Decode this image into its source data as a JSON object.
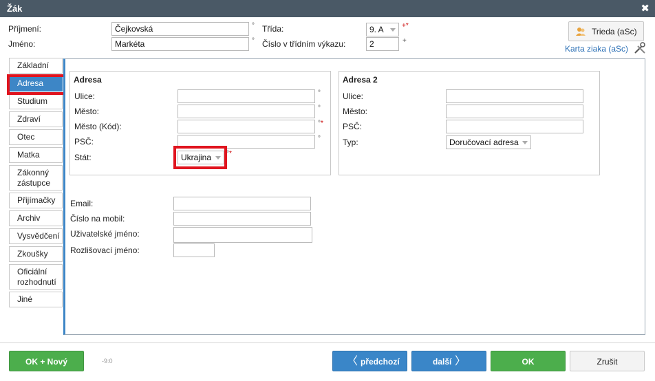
{
  "window": {
    "title": "Žák",
    "close_symbol": "✖"
  },
  "header": {
    "surname_label": "Příjmení:",
    "surname_value": "Čejkovská",
    "name_label": "Jméno:",
    "name_value": "Markéta",
    "marker": "°",
    "class_label": "Třída:",
    "class_value": "9. A",
    "class_marker": "+*",
    "report_number_label": "Číslo v třídním výkazu:",
    "report_number_value": "2",
    "report_number_marker": "+",
    "trieda_button": "Trieda (aSc)",
    "karta_link": "Karta ziaka (aSc)"
  },
  "tabs": [
    {
      "label": "Základní"
    },
    {
      "label": "Adresa",
      "active": true
    },
    {
      "label": "Studium"
    },
    {
      "label": "Zdraví"
    },
    {
      "label": "Otec"
    },
    {
      "label": "Matka"
    },
    {
      "label": "Zákonný zástupce"
    },
    {
      "label": "Přijímačky"
    },
    {
      "label": "Archiv"
    },
    {
      "label": "Vysvědčení"
    },
    {
      "label": "Zkoušky"
    },
    {
      "label": "Oficiální rozhodnutí"
    },
    {
      "label": "Jiné"
    }
  ],
  "address": {
    "title": "Adresa",
    "street_label": "Ulice:",
    "city_label": "Město:",
    "city_code_label": "Město (Kód):",
    "zip_label": "PSČ:",
    "country_label": "Stát:",
    "country_value": "Ukrajina",
    "marker": "°",
    "req_marker": "*"
  },
  "address2": {
    "title": "Adresa 2",
    "street_label": "Ulice:",
    "city_label": "Město:",
    "zip_label": "PSČ:",
    "type_label": "Typ:",
    "type_value": "Doručovací adresa"
  },
  "contact": {
    "email_label": "Email:",
    "mobile_label": "Číslo na mobil:",
    "username_label": "Uživatelské jméno:",
    "distinguishing_name_label": "Rozlišovací jméno:"
  },
  "footer": {
    "ok_new": "OK + Nový",
    "counter": "-9:0",
    "prev": "předchozí",
    "next": "další",
    "ok": "OK",
    "cancel": "Zrušit"
  },
  "colors": {
    "titlebar": "#4a5966",
    "accent_blue": "#3d86c6",
    "green": "#4cae4c",
    "highlight_red": "#e0141e"
  }
}
